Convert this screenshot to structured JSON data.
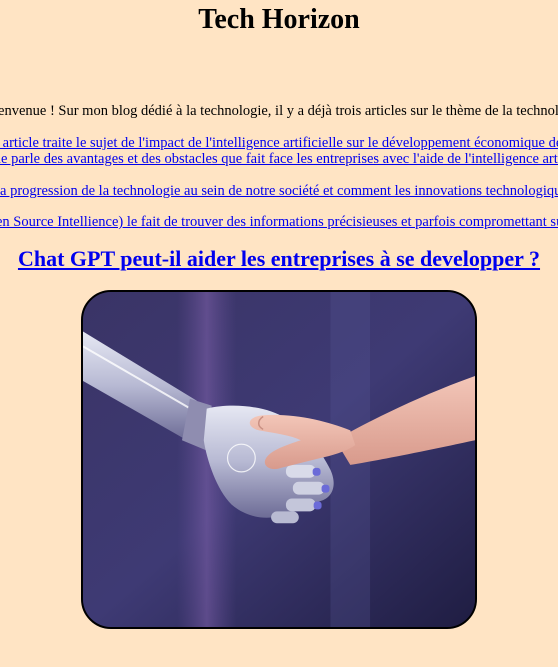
{
  "header": {
    "title": "Tech Horizon"
  },
  "intro": {
    "text": "ienvenue ! Sur mon blog dédié à la technologie, il y a déjà trois articles sur le thème de la technolog"
  },
  "articles": [
    {
      "text": "t article traite le sujet de l'impact de l'intelligence artificielle sur le développement économique des e"
    },
    {
      "text": "le parle des avantages et des obstacles que fait face les entreprises avec l'aide de l'intelligence artific"
    },
    {
      "text": " la progression de la technologie au sein de notre société et comment les innovations technologique"
    },
    {
      "text": "en Source Intellience) le fait de trouver des informations précisieuses et parfois compromettant sur l"
    }
  ],
  "feature": {
    "title": "Chat GPT peut-il aider les entreprises à se developper ?",
    "image_subject": "robot-human-handshake"
  },
  "colors": {
    "background": "#ffe4c4",
    "link": "#0000ee",
    "text": "#000000"
  }
}
